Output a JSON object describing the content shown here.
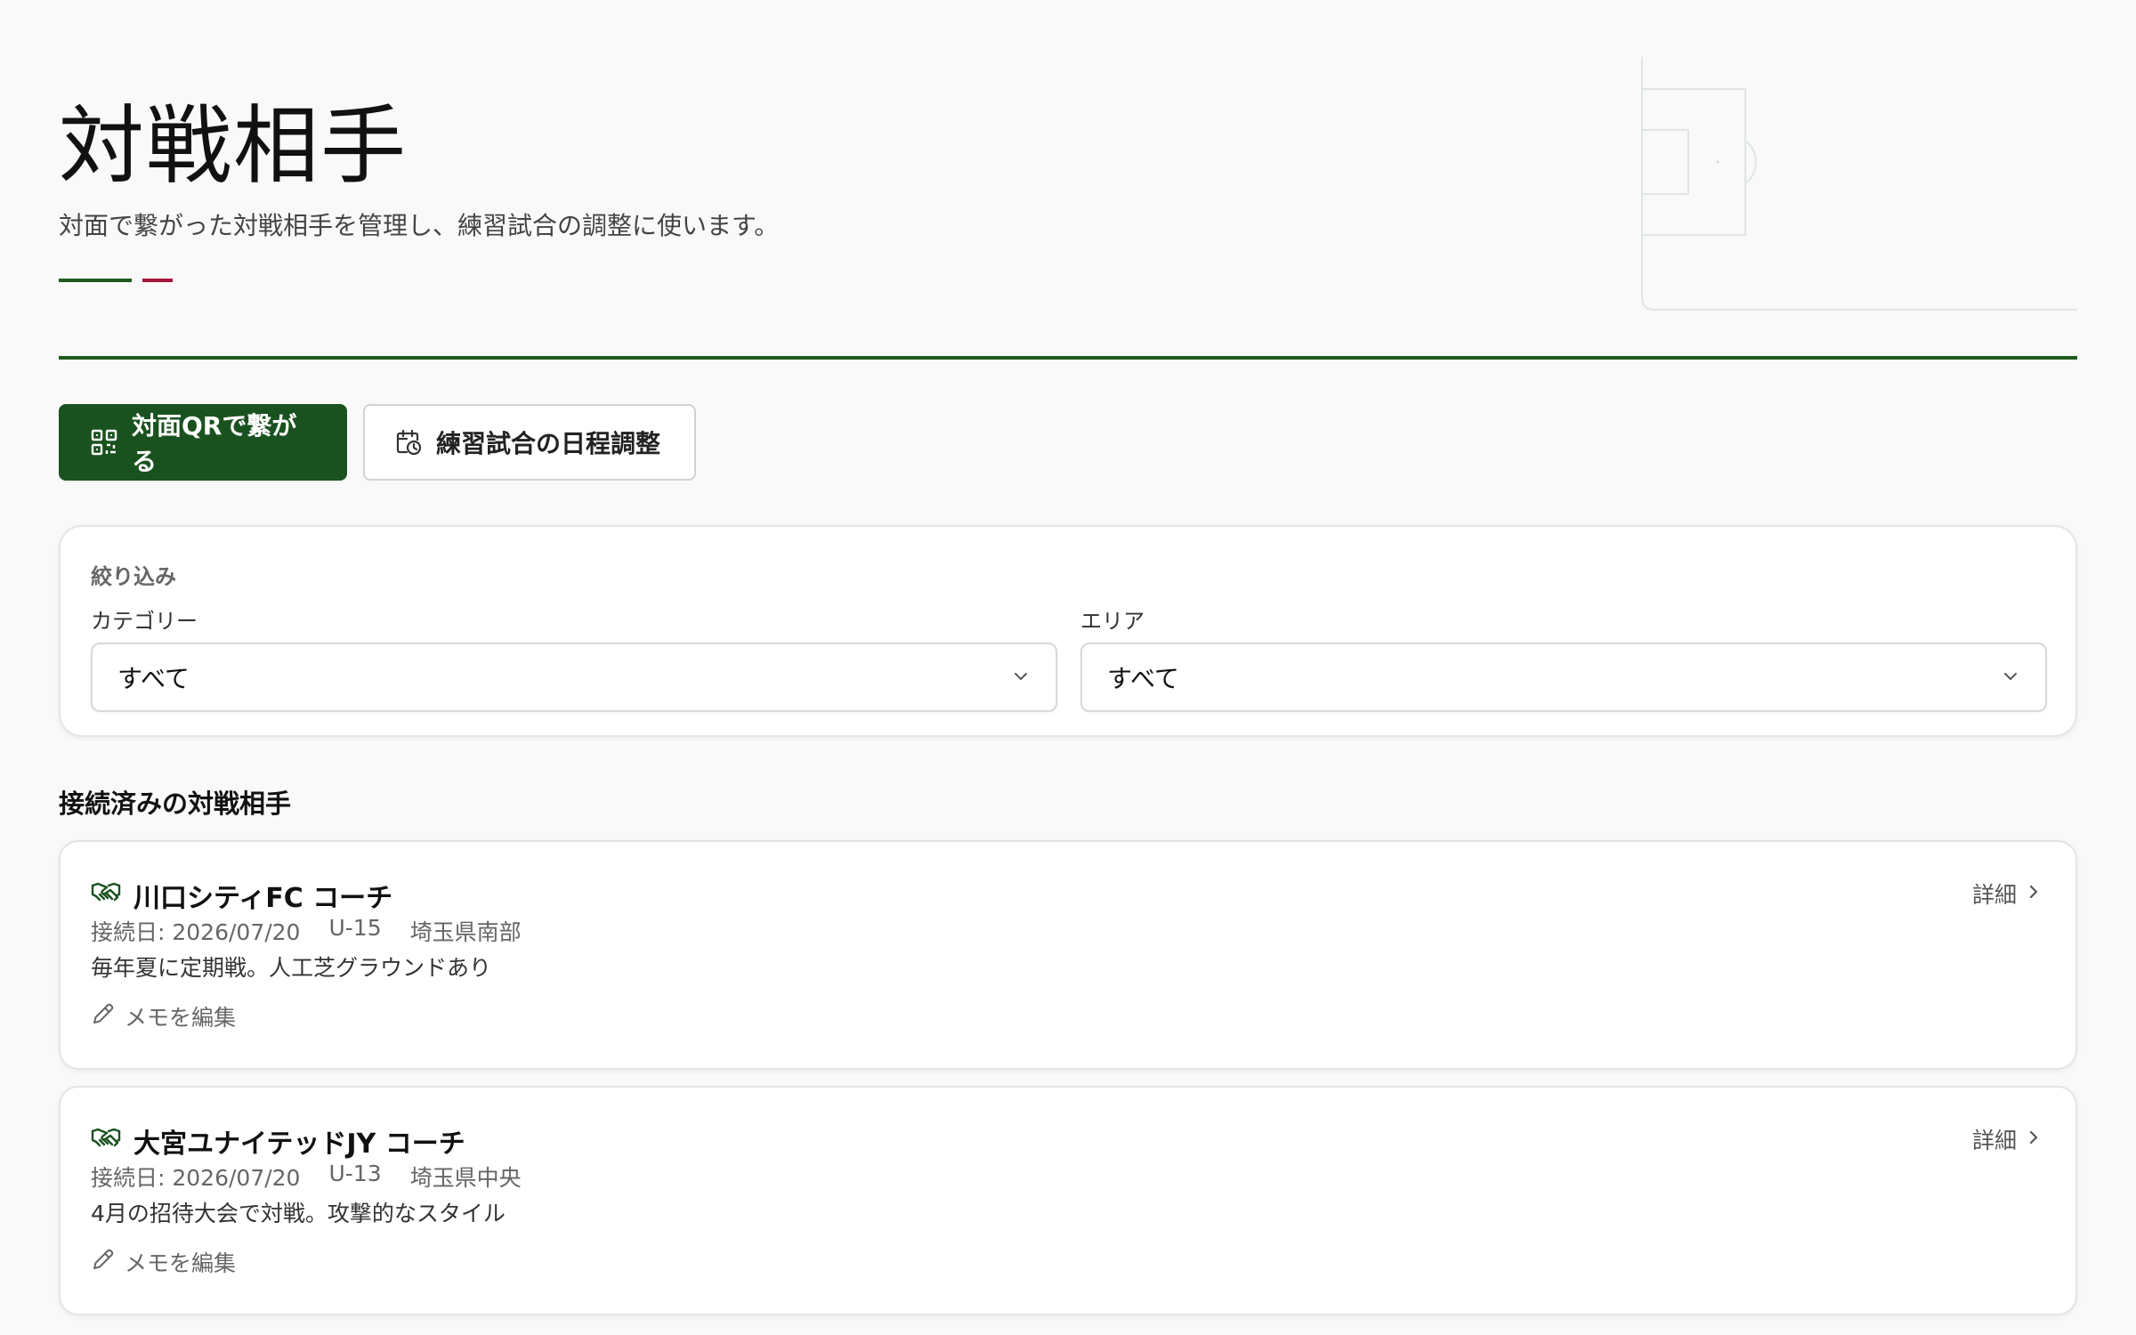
{
  "header": {
    "title": "対戦相手",
    "subtitle": "対面で繋がった対戦相手を管理し、練習試合の調整に使います。"
  },
  "actions": {
    "qr_label": "対面QRで繋がる",
    "schedule_label": "練習試合の日程調整"
  },
  "filter": {
    "heading": "絞り込み",
    "category_label": "カテゴリー",
    "category_value": "すべて",
    "area_label": "エリア",
    "area_value": "すべて"
  },
  "section": {
    "title": "接続済みの対戦相手"
  },
  "opponents": [
    {
      "name": "川口シティFC コーチ",
      "connected": "接続日: 2026/07/20",
      "category": "U-15",
      "area": "埼玉県南部",
      "note": "毎年夏に定期戦。人工芝グラウンドあり",
      "detail_label": "詳細",
      "memo_label": "メモを編集"
    },
    {
      "name": "大宮ユナイテッドJY コーチ",
      "connected": "接続日: 2026/07/20",
      "category": "U-13",
      "area": "埼玉県中央",
      "note": "4月の招待大会で対戦。攻撃的なスタイル",
      "detail_label": "詳細",
      "memo_label": "メモを編集"
    }
  ],
  "colors": {
    "brand_green": "#1a521f",
    "accent_red": "#a3163a"
  },
  "icons": {
    "qr": "qr-code-icon",
    "schedule": "calendar-clock-icon",
    "handshake": "handshake-icon",
    "chevron_down": "chevron-down-icon",
    "chevron_right": "chevron-right-icon",
    "pencil": "pencil-icon"
  }
}
